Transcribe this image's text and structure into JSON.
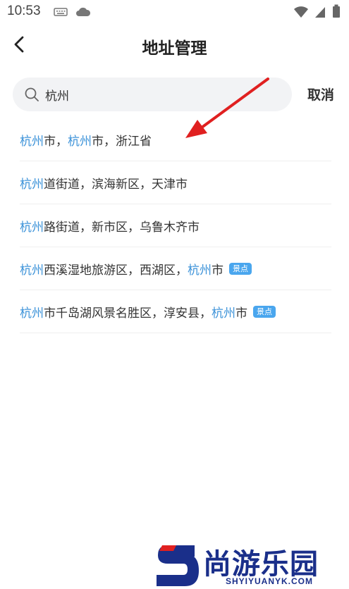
{
  "status_bar": {
    "time": "10:53",
    "left_icons": [
      "keyboard-icon",
      "cloud-icon"
    ],
    "right_icons": [
      "wifi-icon",
      "signal-icon",
      "battery-icon"
    ]
  },
  "nav": {
    "back_icon": "chevron-left-icon",
    "title": "地址管理"
  },
  "search": {
    "value": "杭州",
    "cancel_label": "取消"
  },
  "results": [
    {
      "segments": [
        {
          "text": "杭州",
          "hl": true
        },
        {
          "text": "市，",
          "hl": false
        },
        {
          "text": "杭州",
          "hl": true
        },
        {
          "text": "市，浙江省",
          "hl": false
        }
      ],
      "badge": ""
    },
    {
      "segments": [
        {
          "text": "杭州",
          "hl": true
        },
        {
          "text": "道街道，滨海新区，天津市",
          "hl": false
        }
      ],
      "badge": ""
    },
    {
      "segments": [
        {
          "text": "杭州",
          "hl": true
        },
        {
          "text": "路街道，新市区，乌鲁木齐市",
          "hl": false
        }
      ],
      "badge": ""
    },
    {
      "segments": [
        {
          "text": "杭州",
          "hl": true
        },
        {
          "text": "西溪湿地旅游区，西湖区，",
          "hl": false
        },
        {
          "text": "杭州",
          "hl": true
        },
        {
          "text": "市",
          "hl": false
        }
      ],
      "badge": "景点"
    },
    {
      "segments": [
        {
          "text": "杭州",
          "hl": true
        },
        {
          "text": "市千岛湖风景名胜区，淳安县，",
          "hl": false
        },
        {
          "text": "杭州",
          "hl": true
        },
        {
          "text": "市",
          "hl": false
        }
      ],
      "badge": "景点"
    }
  ],
  "colors": {
    "highlight": "#3d93d9",
    "badge": "#4aa6ee",
    "annotation_arrow": "#e02020",
    "watermark": "#1a2f8a"
  },
  "watermark": {
    "name": "尚游乐园",
    "domain": "SHYIYUANYK.COM"
  }
}
